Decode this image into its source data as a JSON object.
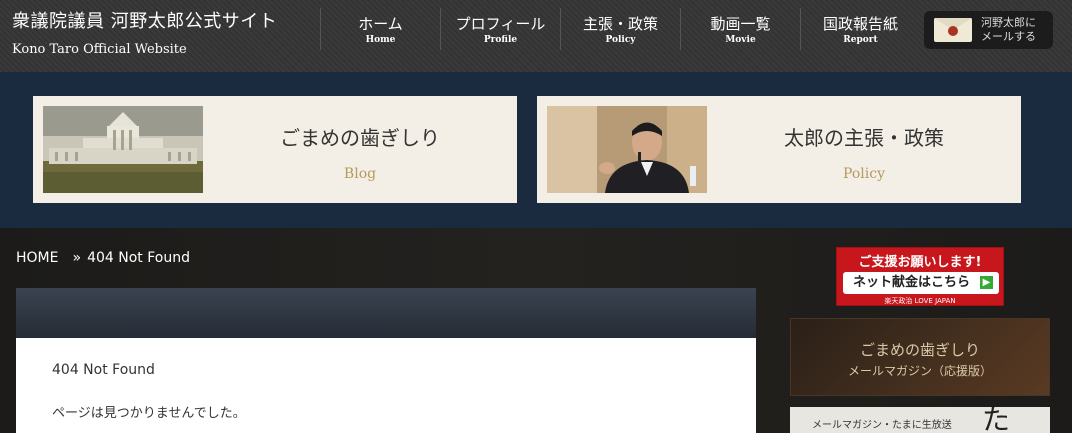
{
  "header": {
    "title": "衆議院議員 河野太郎公式サイト",
    "subtitle": "Kono Taro Official Website",
    "nav": [
      {
        "jp": "ホーム",
        "en": "Home"
      },
      {
        "jp": "プロフィール",
        "en": "Profile"
      },
      {
        "jp": "主張・政策",
        "en": "Policy"
      },
      {
        "jp": "動画一覧",
        "en": "Movie"
      },
      {
        "jp": "国政報告紙",
        "en": "Report"
      }
    ],
    "mail": {
      "line1": "河野太郎に",
      "line2": "メールする"
    }
  },
  "banners": [
    {
      "title": "ごまめの歯ぎしり",
      "en": "Blog"
    },
    {
      "title": "太郎の主張・政策",
      "en": "Policy"
    }
  ],
  "breadcrumb": {
    "home": "HOME",
    "sep": "»",
    "current": "404 Not Found"
  },
  "main": {
    "title": "404 Not Found",
    "message": "ページは見つかりませんでした。"
  },
  "sidebar": {
    "support": {
      "top": "ご支援お願いします!",
      "button": "ネット献金はこちら",
      "footer": "楽天政治 LOVE JAPAN"
    },
    "magazine": {
      "title": "ごまめの歯ぎしり",
      "sub": "メールマガジン（応援版）"
    },
    "tama": {
      "text": "メールマガジン・たまに生放送"
    }
  },
  "colors": {
    "header_bg": "#363636",
    "banner_band": "#1a2a3f",
    "accent_gold": "#b49a5e",
    "support_red": "#c8161d"
  }
}
